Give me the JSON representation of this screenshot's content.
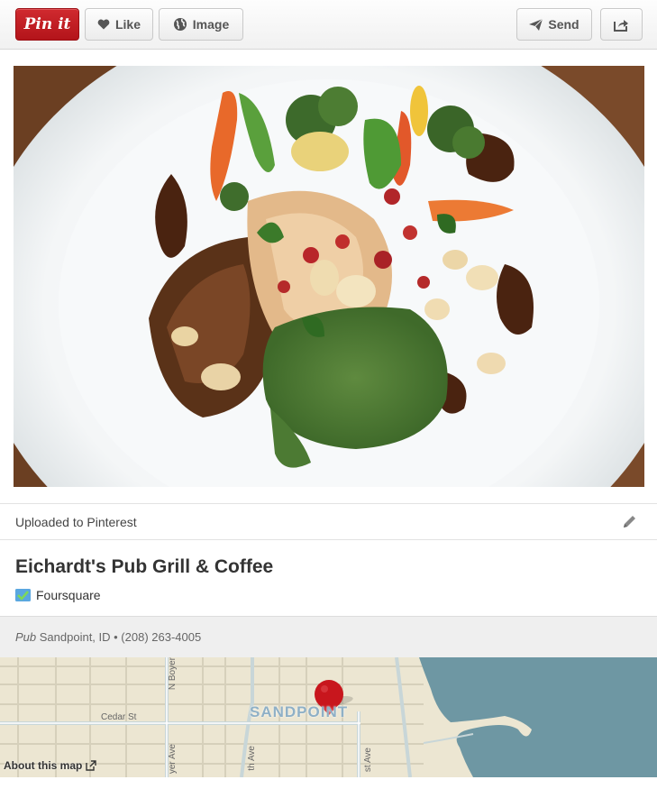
{
  "toolbar": {
    "pin_label": "Pin it",
    "like_label": "Like",
    "image_label": "Image",
    "send_label": "Send"
  },
  "source": {
    "text": "Uploaded to Pinterest"
  },
  "place": {
    "name": "Eichardt's Pub Grill & Coffee",
    "provider": "Foursquare",
    "category": "Pub",
    "location_phone": " Sandpoint, ID • (208) 263-4005"
  },
  "map": {
    "town": "SANDPOINT",
    "streets": {
      "cedar": "Cedar St",
      "boyer": "N Boyer",
      "boyer_ave": "yer Ave",
      "fifth": "th Ave",
      "first": "st Ave"
    },
    "about_link": "About this map"
  },
  "colors": {
    "pin_red": "#c8161d",
    "water": "#6e97a3",
    "land": "#ece6d2"
  }
}
